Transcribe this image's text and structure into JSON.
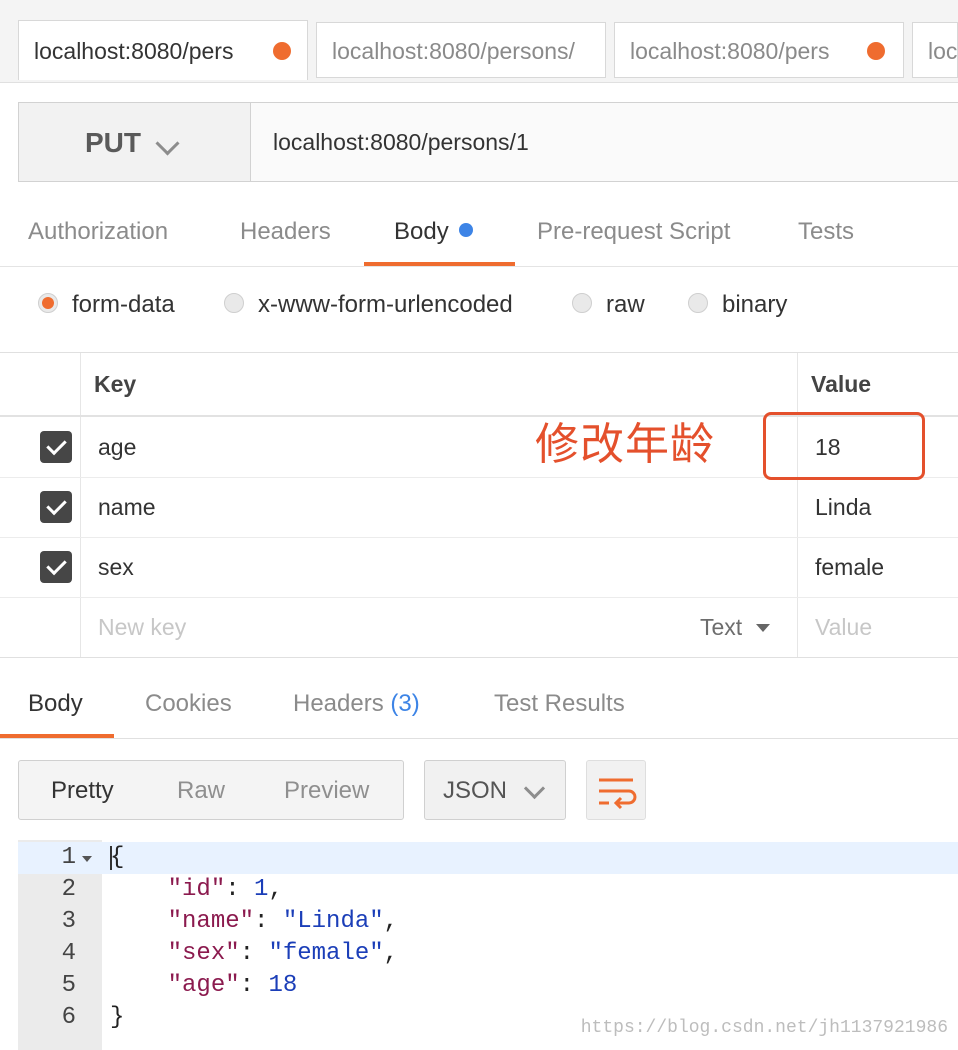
{
  "tabs": [
    {
      "title": "localhost:8080/pers",
      "unsaved": true
    },
    {
      "title": "localhost:8080/persons/",
      "unsaved": false
    },
    {
      "title": "localhost:8080/pers",
      "unsaved": true
    },
    {
      "title": "loc",
      "unsaved": false
    }
  ],
  "request": {
    "method": "PUT",
    "url": "localhost:8080/persons/1"
  },
  "request_tabs": [
    "Authorization",
    "Headers",
    "Body",
    "Pre-request Script",
    "Tests"
  ],
  "body_types": [
    "form-data",
    "x-www-form-urlencoded",
    "raw",
    "binary"
  ],
  "selected_body_type": "form-data",
  "form_table": {
    "headers": {
      "key": "Key",
      "value": "Value"
    },
    "rows": [
      {
        "key": "age",
        "value": "18",
        "checked": true
      },
      {
        "key": "name",
        "value": "Linda",
        "checked": true
      },
      {
        "key": "sex",
        "value": "female",
        "checked": true
      }
    ],
    "new_row": {
      "key_placeholder": "New key",
      "type": "Text",
      "value_placeholder": "Value"
    }
  },
  "annotation": {
    "text": "修改年龄",
    "color": "#e4502c"
  },
  "response_tabs": {
    "body": "Body",
    "cookies": "Cookies",
    "headers": "Headers",
    "headers_count": "(3)",
    "test_results": "Test Results"
  },
  "view_modes": [
    "Pretty",
    "Raw",
    "Preview"
  ],
  "format": "JSON",
  "response_lines": [
    {
      "n": "1",
      "fold": true
    },
    {
      "n": "2"
    },
    {
      "n": "3"
    },
    {
      "n": "4"
    },
    {
      "n": "5"
    },
    {
      "n": "6"
    }
  ],
  "response_json": {
    "open": "{",
    "close": "}",
    "id_key": "\"id\"",
    "id_val": "1",
    "name_key": "\"name\"",
    "name_val": "\"Linda\"",
    "sex_key": "\"sex\"",
    "sex_val": "\"female\"",
    "age_key": "\"age\"",
    "age_val": "18"
  },
  "watermark": "https://blog.csdn.net/jh1137921986",
  "colors": {
    "accent": "#ef6c2f",
    "blue": "#3d84e6"
  }
}
